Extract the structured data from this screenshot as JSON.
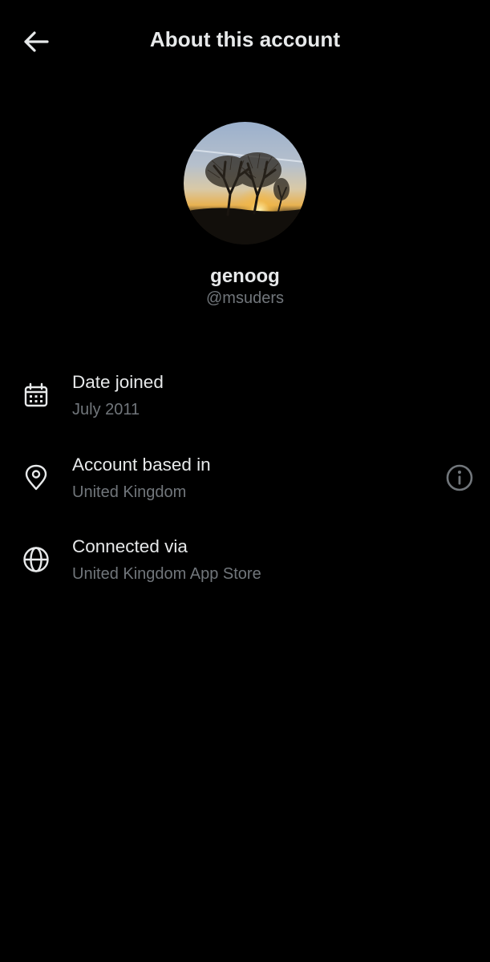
{
  "header": {
    "title": "About this account",
    "back_icon": "arrow-left-icon"
  },
  "profile": {
    "display_name": "genoog",
    "handle": "@msuders",
    "avatar_description_icon": "avatar"
  },
  "details": [
    {
      "icon": "calendar-icon",
      "title": "Date joined",
      "value": "July 2011"
    },
    {
      "icon": "location-pin-icon",
      "title": "Account based in",
      "value": "United Kingdom",
      "trailing_icon": "info-icon"
    },
    {
      "icon": "globe-icon",
      "title": "Connected via",
      "value": "United Kingdom App Store"
    }
  ],
  "colors": {
    "background": "#000000",
    "primary_text": "#e7e9ea",
    "secondary_text": "#71767b"
  }
}
